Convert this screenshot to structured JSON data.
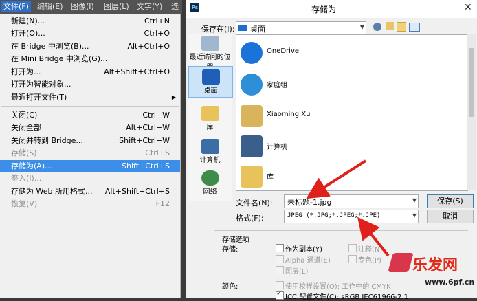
{
  "menubar": {
    "items": [
      "文件(F)",
      "编辑(E)",
      "图像(I)",
      "图层(L)",
      "文字(Y)",
      "选"
    ]
  },
  "filemenu": {
    "items": [
      {
        "label": "新建(N)...",
        "shortcut": "Ctrl+N"
      },
      {
        "label": "打开(O)...",
        "shortcut": "Ctrl+O"
      },
      {
        "label": "在 Bridge 中浏览(B)...",
        "shortcut": "Alt+Ctrl+O"
      },
      {
        "label": "在 Mini Bridge 中浏览(G)...",
        "shortcut": ""
      },
      {
        "label": "打开为...",
        "shortcut": "Alt+Shift+Ctrl+O"
      },
      {
        "label": "打开为智能对象...",
        "shortcut": ""
      },
      {
        "label": "最近打开文件(T)",
        "shortcut": ""
      },
      {
        "label": "关闭(C)",
        "shortcut": "Ctrl+W"
      },
      {
        "label": "关闭全部",
        "shortcut": "Alt+Ctrl+W"
      },
      {
        "label": "关闭并转到 Bridge...",
        "shortcut": "Shift+Ctrl+W"
      },
      {
        "label": "存储(S)",
        "shortcut": "Ctrl+S"
      },
      {
        "label": "存储为(A)...",
        "shortcut": "Shift+Ctrl+S"
      },
      {
        "label": "签入(I)...",
        "shortcut": ""
      },
      {
        "label": "存储为 Web 所用格式...",
        "shortcut": "Alt+Shift+Ctrl+S"
      },
      {
        "label": "恢复(V)",
        "shortcut": "F12"
      }
    ]
  },
  "dialog": {
    "ps_badge": "Ps",
    "title": "存储为",
    "close": "✕",
    "save_in_label": "保存在(I):",
    "save_in_value": "桌面",
    "places": [
      "最近访问的位置",
      "桌面",
      "库",
      "计算机",
      "网络"
    ],
    "files": [
      "OneDrive",
      "家庭组",
      "Xiaoming Xu",
      "计算机",
      "库"
    ],
    "filename_label": "文件名(N):",
    "filename_value": "未标题-1.jpg",
    "format_label": "格式(F):",
    "format_value": "JPEG (*.JPG;*.JPEG;*.JPE)",
    "save_button": "保存(S)",
    "cancel_button": "取消",
    "options": {
      "group_label": "存储选项",
      "save_label": "存储:",
      "as_copy": "作为副本(Y)",
      "notes": "注释(N)",
      "alpha": "Alpha 通道(E)",
      "spot": "专色(P)",
      "layers": "图层(L)",
      "color_label": "颜色:",
      "use_proof": "使用校样设置(O):  工作中的 CMYK",
      "icc": "ICC 配置文件(C):  sRGB IEC61966-2.1"
    }
  },
  "watermark": {
    "text": "乐发网",
    "url": "www.6pf.cn"
  }
}
